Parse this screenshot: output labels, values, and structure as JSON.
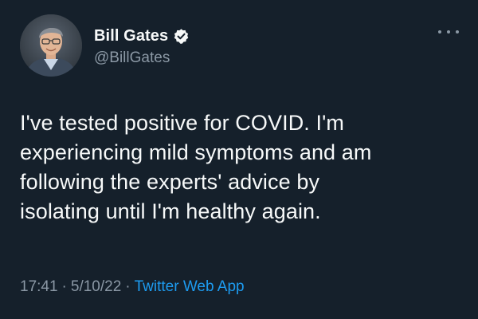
{
  "author": {
    "display_name": "Bill Gates",
    "handle": "@BillGates",
    "verified": true,
    "avatar_icon": "profile-photo"
  },
  "tweet": {
    "lines": [
      "I've tested positive for COVID. I'm",
      "experiencing mild symptoms and am",
      "following the experts' advice by",
      "isolating until I'm healthy again."
    ]
  },
  "meta": {
    "time": "17:41",
    "separator": "·",
    "date": "5/10/22",
    "source": "Twitter Web App"
  },
  "icons": {
    "verified": "verified-badge-icon",
    "more": "more-options-icon"
  },
  "colors": {
    "background": "#15202b",
    "text": "#f7f9f9",
    "secondary_text": "#8b98a5",
    "accent": "#1d9bf0"
  }
}
